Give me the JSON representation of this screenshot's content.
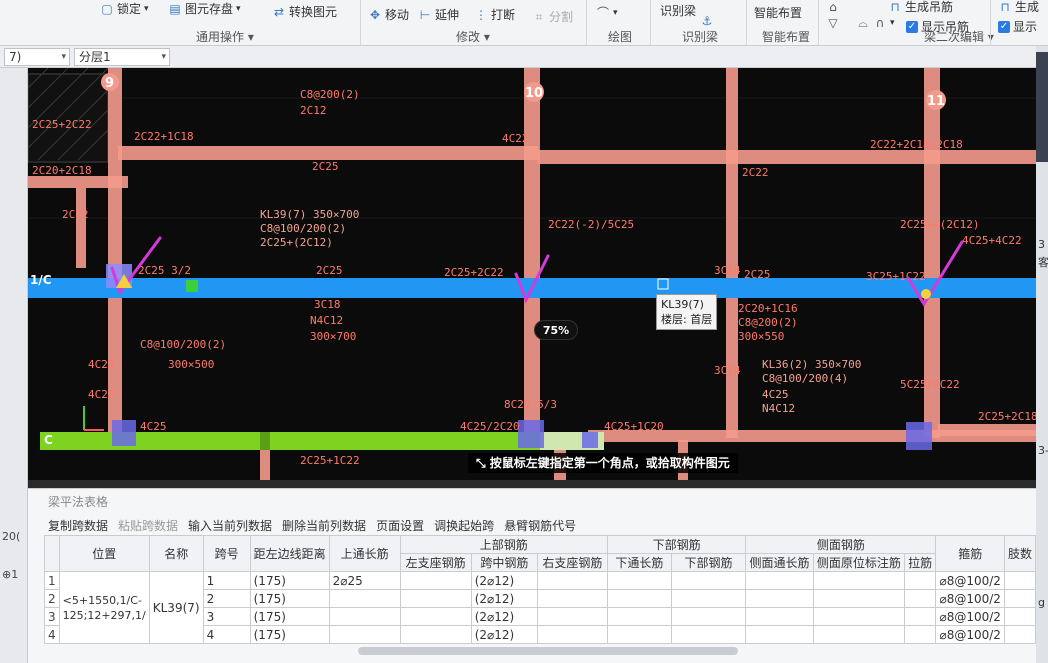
{
  "ribbon": {
    "lock": "锁定",
    "save_element": "图元存盘",
    "convert_element": "转换图元",
    "move": "移动",
    "extend": "延伸",
    "break": "打断",
    "split": "分割",
    "identify_beam": "识别梁",
    "smart_layout": "智能布置",
    "gen_hanger": "生成吊筋",
    "show_hanger": "显示吊筋",
    "gen2": "生成",
    "show2": "显示",
    "groups": {
      "general": "通用操作",
      "modify": "修改",
      "draw": "绘图",
      "identify": "识别梁",
      "smart": "智能布置",
      "secondary": "梁二次编辑"
    }
  },
  "toolbar": {
    "floor_combo": "7)",
    "layer_combo": "分层1"
  },
  "canvas": {
    "axes": {
      "a9": "9",
      "a10": "10",
      "a11": "11",
      "row_c": "C",
      "row_1c": "1/C"
    },
    "labels": {
      "l01": "C8@200(2)",
      "l02": "2C12",
      "l03": "2C22+1C18",
      "l04": "2C20+2C18",
      "l05": "2C25",
      "l06": "KL39(7) 350×700",
      "l07": "C8@100/200(2)",
      "l08": "2C25+(2C12)",
      "l09": "2C25 3/2",
      "l10": "2C25",
      "l11": "2C25+2C22",
      "l12": "3C18",
      "l13": "N4C12",
      "l14": "300×700",
      "l15": "4C22",
      "l16": "C8@100/200(2)",
      "l17": "300×500",
      "l18": "4C25",
      "l19": "2C25+1C22",
      "l20": "4C25/2C20",
      "l21": "8C25 5/3",
      "l22": "4C25+1C20",
      "l23": "2C22",
      "l24": "2C22+2C18/2C18",
      "l25": "2C22(-2)/5C25",
      "l26": "2C20+1C16",
      "l27": "C8@200(2)",
      "l28": "300×550",
      "l29": "KL36(2) 350×700",
      "l30": "C8@100/200(4)",
      "l31": "4C25",
      "l32": "N4C12",
      "l33": "3C25+1C22",
      "l34": "5C25/4C22",
      "l35": "2C25+2C18",
      "l36": "4C25+4C22",
      "l37": "3C14",
      "l38": "3C14",
      "l39": "2C25+4(2C12)",
      "l40": "2C25",
      "l41": "4C22",
      "l42": "4C22",
      "l43": "2C22",
      "l44": "2C25+2C22"
    },
    "tooltip": {
      "name": "KL39(7)",
      "floor": "楼层: 首层"
    },
    "zoom": "75%",
    "status": "按鼠标左键指定第一个角点，或拾取构件图元"
  },
  "panel": {
    "title": "梁平法表格",
    "toolbar": [
      "复制跨数据",
      "粘贴跨数据",
      "输入当前列数据",
      "删除当前列数据",
      "页面设置",
      "调换起始跨",
      "悬臂钢筋代号"
    ],
    "headers": {
      "position": "位置",
      "name": "名称",
      "span": "跨号",
      "top_rebar": "上部钢筋",
      "bottom_rebar": "下部钢筋",
      "side_rebar": "侧面钢筋",
      "dist_left": "距左边线距离",
      "top_through": "上通长筋",
      "left_support": "左支座钢筋",
      "mid_span": "跨中钢筋",
      "right_support": "右支座钢筋",
      "bottom_through": "下通长筋",
      "bottom_bar": "下部钢筋",
      "side_through": "侧面通长筋",
      "side_original": "侧面原位标注筋",
      "tie": "拉筋",
      "stirrup": "箍筋",
      "limb": "肢数"
    },
    "position_value": "<5+1550,1/C-125;12+297,1/",
    "name_value": "KL39(7)",
    "rows": [
      {
        "idx": "1",
        "span": "1",
        "dist": "(175)",
        "top_through": "2⌀25",
        "mid": "(2⌀12)",
        "stirrup": "⌀8@100/2"
      },
      {
        "idx": "2",
        "span": "2",
        "dist": "(175)",
        "top_through": "",
        "mid": "(2⌀12)",
        "stirrup": "⌀8@100/2"
      },
      {
        "idx": "3",
        "span": "3",
        "dist": "(175)",
        "top_through": "",
        "mid": "(2⌀12)",
        "stirrup": "⌀8@100/2"
      },
      {
        "idx": "4",
        "span": "4",
        "dist": "(175)",
        "top_through": "",
        "mid": "(2⌀12)",
        "stirrup": "⌀8@100/2"
      }
    ]
  },
  "left_strip": {
    "t1": "20(",
    "t2": "⊕1"
  },
  "right_panel": {
    "r1": "3",
    "r2": "客",
    "r3": "3-",
    "r4": "g"
  },
  "colors": {
    "beam_blue": "#2196f3",
    "beam_green": "#7ed321",
    "beam_pink": "#f49a8c",
    "check_magenta": "#d63ad6"
  }
}
